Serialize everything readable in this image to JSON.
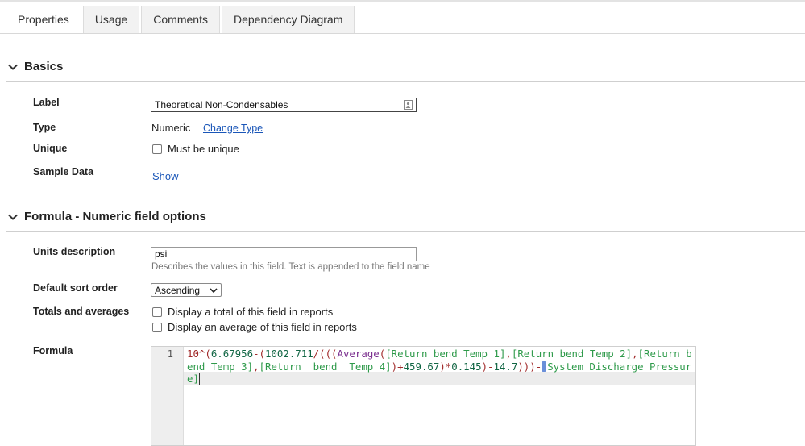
{
  "tabs": [
    "Properties",
    "Usage",
    "Comments",
    "Dependency Diagram"
  ],
  "active_tab": "Properties",
  "basics": {
    "title": "Basics",
    "label_label": "Label",
    "label_value": "Theoretical Non-Condensables",
    "type_label": "Type",
    "type_value": "Numeric",
    "change_type": "Change Type",
    "unique_label": "Unique",
    "unique_option": "Must be unique",
    "sample_label": "Sample Data",
    "sample_show": "Show"
  },
  "formula_section": {
    "title": "Formula - Numeric field options",
    "units_label": "Units description",
    "units_value": "psi",
    "units_help": "Describes the values in this field. Text is appended to the field name",
    "sort_label": "Default sort order",
    "sort_value": "Ascending",
    "totals_label": "Totals and averages",
    "total_option": "Display a total of this field in reports",
    "average_option": "Display an average of this field in reports",
    "formula_label": "Formula",
    "line_number": "1",
    "formula_tokens": [
      {
        "t": "10^(",
        "c": "c-op"
      },
      {
        "t": "6.67956",
        "c": "c-num"
      },
      {
        "t": "-(",
        "c": "c-op"
      },
      {
        "t": "1002.711",
        "c": "c-num"
      },
      {
        "t": "/(((",
        "c": "c-op"
      },
      {
        "t": "Average",
        "c": "c-fn"
      },
      {
        "t": "(",
        "c": "c-op"
      },
      {
        "t": "[Return bend Temp 1]",
        "c": "c-br"
      },
      {
        "t": ",",
        "c": "c-op"
      },
      {
        "t": "[Return bend Temp 2]",
        "c": "c-br"
      },
      {
        "t": ",",
        "c": "c-op"
      },
      {
        "t": "[Return bend Temp 3]",
        "c": "c-br"
      },
      {
        "t": ",",
        "c": "c-op"
      },
      {
        "t": "[Return  bend  Temp 4]",
        "c": "c-br"
      },
      {
        "t": ")+",
        "c": "c-op"
      },
      {
        "t": "459.67",
        "c": "c-num"
      },
      {
        "t": ")*",
        "c": "c-op"
      },
      {
        "t": "0.145",
        "c": "c-num"
      },
      {
        "t": ")-",
        "c": "c-op"
      },
      {
        "t": "14.7",
        "c": "c-num"
      },
      {
        "t": ")))-",
        "c": "c-op"
      },
      {
        "t": "[",
        "c": "c-cursor-tok"
      },
      {
        "t": "System Discharge Pressure]",
        "c": "c-br"
      }
    ]
  },
  "icons": {
    "section_toggle": "chevron-down-icon",
    "input_badge": "contact-card-icon"
  },
  "colors": {
    "link": "#1a56b8",
    "code_number": "#116644",
    "code_function": "#7a2e8e",
    "code_field": "#2e9a4a"
  }
}
